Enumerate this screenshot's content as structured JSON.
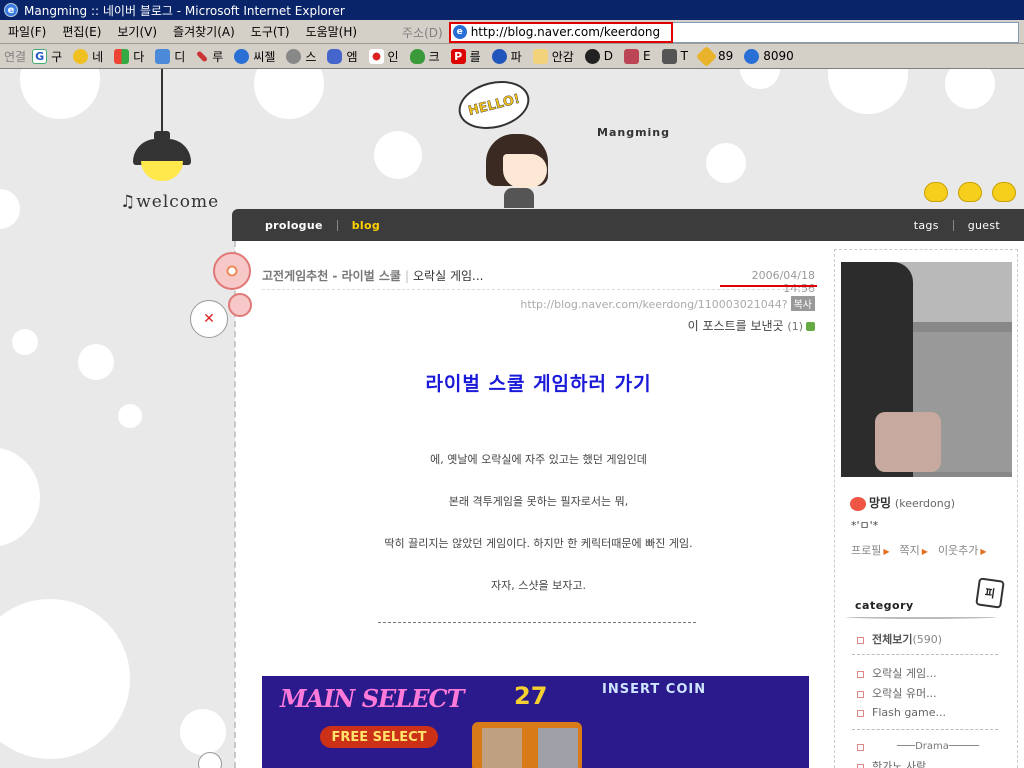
{
  "window": {
    "title": "Mangming :: 네이버 블로그 - Microsoft Internet Explorer"
  },
  "menu": [
    "파일(F)",
    "편집(E)",
    "보기(V)",
    "즐겨찾기(A)",
    "도구(T)",
    "도움말(H)"
  ],
  "address": {
    "label": "주소(D)",
    "url": "http://blog.naver.com/keerdong"
  },
  "links_bar": {
    "label": "연결",
    "items": [
      {
        "label": "구",
        "icon": "google-icon"
      },
      {
        "label": "네",
        "icon": "face-icon"
      },
      {
        "label": "다",
        "icon": "windows-icon"
      },
      {
        "label": "디",
        "icon": "page-icon"
      },
      {
        "label": "루",
        "icon": "tools-icon"
      },
      {
        "label": "씨젤",
        "icon": "ie-icon"
      },
      {
        "label": "스",
        "icon": "speaker-icon"
      },
      {
        "label": "엠",
        "icon": "tv-icon"
      },
      {
        "label": "인",
        "icon": "flag-icon"
      },
      {
        "label": "크",
        "icon": "cloud-icon"
      },
      {
        "label": "를",
        "icon": "p-icon"
      },
      {
        "label": "파",
        "icon": "globe-icon"
      },
      {
        "label": "안감",
        "icon": "folder-icon"
      },
      {
        "label": "D",
        "icon": "dnn-icon"
      },
      {
        "label": "E",
        "icon": "person-icon"
      },
      {
        "label": "T",
        "icon": "camera-icon"
      },
      {
        "label": "89",
        "icon": "puzzle-icon"
      },
      {
        "label": "8090",
        "icon": "ie-icon"
      }
    ]
  },
  "header": {
    "hello": "HELLO!",
    "blog_name": "Mangming",
    "welcome": "♫welcome"
  },
  "nav": {
    "left": [
      "prologue",
      "blog"
    ],
    "right": [
      "tags",
      "guest"
    ],
    "active": "blog"
  },
  "post": {
    "category": "고전게임추천 - 라이벌 스쿨",
    "title": "오락실 게임...",
    "date": "2006/04/18 14:56",
    "url": "http://blog.naver.com/keerdong/110003021044?",
    "url_text": "http://blog.naver.com/keerdong/110003021044?",
    "copy": "복사",
    "send": "이 포스트를 보낸곳",
    "send_count": "(1)",
    "link_text": "라이벌 스쿨 게임하러 가기",
    "lines": [
      "에, 옛날에 오락실에 자주 있고는 했던 게임인데",
      "본래 격투게임을 못하는 필자로서는 뭐,",
      "딱히 끌리지는 않았던 게임이다. 하지만 한 케릭터때문에 빠진 게임.",
      "자자, 스샷을 보자고."
    ],
    "divider": "------------------------------------------------------------------------"
  },
  "screenshot": {
    "main_select": "MAIN SELECT",
    "free_select": "FREE SELECT",
    "timer": "27",
    "insert_coin": "INSERT COIN"
  },
  "sidebar": {
    "name": "망밍",
    "id": "(keerdong)",
    "status": "*'ㅁ'*",
    "links": [
      "프로필",
      "쪽지",
      "이웃추가"
    ],
    "category_title": "category",
    "sign": "피",
    "categories": [
      {
        "label": "전체보기",
        "count": "(590)"
      },
      {
        "label": "오락실 게임...",
        "count": ""
      },
      {
        "label": "오락실 유머...",
        "count": ""
      },
      {
        "label": "Flash game...",
        "count": ""
      }
    ],
    "drama": "Drama",
    "last_item": "한가노 사람"
  },
  "colors": {
    "accent_red": "#e00000",
    "link_blue": "#1a1ad8",
    "nav_active": "#ffd200",
    "nav_bg": "#3c3c3c"
  }
}
